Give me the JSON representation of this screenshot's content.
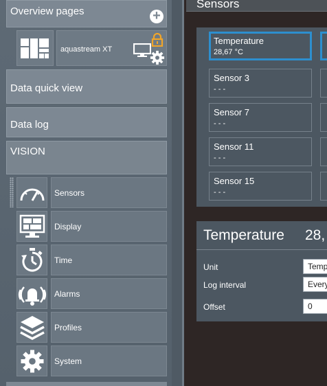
{
  "sidebar": {
    "overview_title": "Overview pages",
    "overview_item_label": "aquastream XT",
    "quick_view": "Data quick view",
    "data_log": "Data log",
    "vision": "VISION",
    "vision_items": [
      {
        "label": "Sensors",
        "icon": "gauge-icon"
      },
      {
        "label": "Display",
        "icon": "display-layout-icon"
      },
      {
        "label": "Time",
        "icon": "stopwatch-icon"
      },
      {
        "label": "Alarms",
        "icon": "alarm-bell-icon"
      },
      {
        "label": "Profiles",
        "icon": "layers-icon"
      },
      {
        "label": "System",
        "icon": "gear-icon"
      }
    ]
  },
  "main": {
    "title": "Sensors",
    "sensors": [
      {
        "name": "Temperature",
        "value": "28,67 °C"
      },
      {
        "name": "Sensor 3",
        "value": "- - -"
      },
      {
        "name": "Sensor 7",
        "value": "- - -"
      },
      {
        "name": "Sensor 11",
        "value": "- - -"
      },
      {
        "name": "Sensor 15",
        "value": "- - -"
      }
    ],
    "detail": {
      "title": "Temperature",
      "value": "28,",
      "fields": [
        {
          "label": "Unit",
          "value": "Temp"
        },
        {
          "label": "Log interval",
          "value": "Every"
        },
        {
          "label": "Offset",
          "value": "0"
        }
      ]
    }
  },
  "colors": {
    "accent": "#2d8fcf",
    "lock": "#f0a52a",
    "sidebar_bg": "#5e6a75",
    "main_bg": "#2e2625",
    "panel_bg": "#4c5761"
  }
}
